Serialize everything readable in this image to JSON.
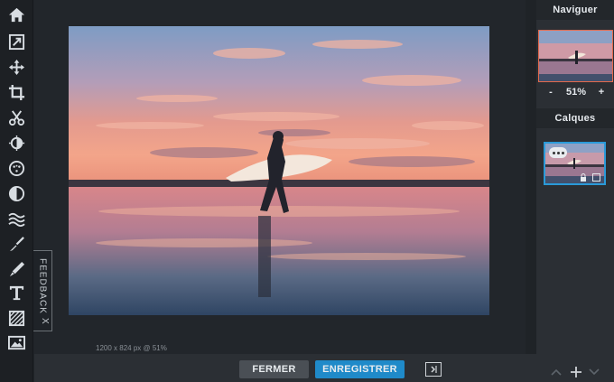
{
  "toolbar": {
    "tools": [
      {
        "name": "home-icon"
      },
      {
        "name": "resize-icon"
      },
      {
        "name": "move-icon"
      },
      {
        "name": "crop-icon"
      },
      {
        "name": "cut-icon"
      },
      {
        "name": "adjust-icon"
      },
      {
        "name": "filter-icon"
      },
      {
        "name": "vignette-icon"
      },
      {
        "name": "wave-icon"
      },
      {
        "name": "brush-icon"
      },
      {
        "name": "pen-icon"
      },
      {
        "name": "text-icon"
      },
      {
        "name": "texture-icon"
      },
      {
        "name": "image-icon"
      }
    ]
  },
  "feedback": {
    "label": "FEEDBACK",
    "close": "X"
  },
  "canvas": {
    "status": "1200 x 824 px @ 51%"
  },
  "actions": {
    "close_label": "FERMER",
    "save_label": "ENREGISTRER"
  },
  "navigator": {
    "title": "Naviguer",
    "zoom_minus": "-",
    "zoom_value": "51%",
    "zoom_plus": "+"
  },
  "layers": {
    "title": "Calques"
  },
  "colors": {
    "accent": "#1f8ac9",
    "nav_border": "#e46a4d",
    "layer_border": "#2a9ad8"
  }
}
